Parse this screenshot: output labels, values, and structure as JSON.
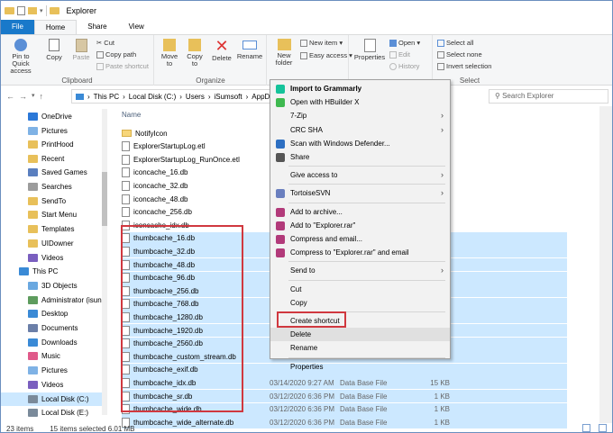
{
  "window": {
    "title": "Explorer"
  },
  "tabs": [
    {
      "label": "File"
    },
    {
      "label": "Home"
    },
    {
      "label": "Share"
    },
    {
      "label": "View"
    }
  ],
  "ribbon": {
    "clipboard": {
      "label": "Clipboard",
      "pin": "Pin to Quick access",
      "copy": "Copy",
      "paste": "Paste",
      "cut": "Cut",
      "copy_path": "Copy path",
      "paste_shortcut": "Paste shortcut"
    },
    "organize": {
      "label": "Organize",
      "move_to": "Move to",
      "copy_to": "Copy to",
      "delete": "Delete",
      "rename": "Rename"
    },
    "new": {
      "new_folder": "New folder",
      "new_item": "New item ▾",
      "easy_access": "Easy access ▾"
    },
    "open": {
      "properties": "Properties",
      "open": "Open ▾",
      "edit": "Edit",
      "history": "History"
    },
    "select": {
      "label": "Select",
      "select_all": "Select all",
      "select_none": "Select none",
      "invert": "Invert selection"
    }
  },
  "address": {
    "crumbs": [
      "This PC",
      "Local Disk (C:)",
      "Users",
      "iSumsoft",
      "AppD"
    ],
    "search_placeholder": "Search Explorer"
  },
  "sidebar": [
    {
      "label": "OneDrive",
      "color": "#2b78d8"
    },
    {
      "label": "Pictures",
      "color": "#7fb2e5"
    },
    {
      "label": "PrintHood",
      "color": "#e8c05a"
    },
    {
      "label": "Recent",
      "color": "#e8c05a"
    },
    {
      "label": "Saved Games",
      "color": "#5a7fbf"
    },
    {
      "label": "Searches",
      "color": "#9c9c9c"
    },
    {
      "label": "SendTo",
      "color": "#e8c05a"
    },
    {
      "label": "Start Menu",
      "color": "#e8c05a"
    },
    {
      "label": "Templates",
      "color": "#e8c05a"
    },
    {
      "label": "UIDowner",
      "color": "#e8c05a"
    },
    {
      "label": "Videos",
      "color": "#7a5fbf"
    },
    {
      "label": "This PC",
      "color": "#3a8ad6"
    },
    {
      "label": "3D Objects",
      "color": "#6aa8e0"
    },
    {
      "label": "Administrator (isuns",
      "color": "#5e9c5e"
    },
    {
      "label": "Desktop",
      "color": "#3a8ad6"
    },
    {
      "label": "Documents",
      "color": "#6b7fa8"
    },
    {
      "label": "Downloads",
      "color": "#3a8ad6"
    },
    {
      "label": "Music",
      "color": "#e05a8a"
    },
    {
      "label": "Pictures",
      "color": "#7fb2e5"
    },
    {
      "label": "Videos",
      "color": "#7a5fbf"
    },
    {
      "label": "Local Disk (C:)",
      "color": "#7a8a9a"
    },
    {
      "label": "Local Disk (E:)",
      "color": "#7a8a9a"
    }
  ],
  "files": {
    "header": "Name",
    "rows": [
      {
        "name": "NotifyIcon",
        "type_icon": "folder",
        "sel": false,
        "date": "",
        "ftype": "",
        "size": ""
      },
      {
        "name": "ExplorerStartupLog.etl",
        "type_icon": "file",
        "sel": false,
        "date": "",
        "ftype": "",
        "size": ""
      },
      {
        "name": "ExplorerStartupLog_RunOnce.etl",
        "type_icon": "file",
        "sel": false,
        "date": "",
        "ftype": "",
        "size": ""
      },
      {
        "name": "iconcache_16.db",
        "type_icon": "file",
        "sel": false,
        "date": "",
        "ftype": "",
        "size": ""
      },
      {
        "name": "iconcache_32.db",
        "type_icon": "file",
        "sel": false,
        "date": "",
        "ftype": "",
        "size": ""
      },
      {
        "name": "iconcache_48.db",
        "type_icon": "file",
        "sel": false,
        "date": "",
        "ftype": "",
        "size": ""
      },
      {
        "name": "iconcache_256.db",
        "type_icon": "file",
        "sel": false,
        "date": "",
        "ftype": "",
        "size": ""
      },
      {
        "name": "iconcache_idx.db",
        "type_icon": "file",
        "sel": false,
        "date": "",
        "ftype": "",
        "size": ""
      },
      {
        "name": "thumbcache_16.db",
        "type_icon": "file",
        "sel": true,
        "date": "",
        "ftype": "",
        "size": ""
      },
      {
        "name": "thumbcache_32.db",
        "type_icon": "file",
        "sel": true,
        "date": "",
        "ftype": "",
        "size": ""
      },
      {
        "name": "thumbcache_48.db",
        "type_icon": "file",
        "sel": true,
        "date": "",
        "ftype": "",
        "size": ""
      },
      {
        "name": "thumbcache_96.db",
        "type_icon": "file",
        "sel": true,
        "date": "",
        "ftype": "",
        "size": ""
      },
      {
        "name": "thumbcache_256.db",
        "type_icon": "file",
        "sel": true,
        "date": "",
        "ftype": "",
        "size": ""
      },
      {
        "name": "thumbcache_768.db",
        "type_icon": "file",
        "sel": true,
        "date": "",
        "ftype": "",
        "size": ""
      },
      {
        "name": "thumbcache_1280.db",
        "type_icon": "file",
        "sel": true,
        "date": "",
        "ftype": "",
        "size": ""
      },
      {
        "name": "thumbcache_1920.db",
        "type_icon": "file",
        "sel": true,
        "date": "",
        "ftype": "",
        "size": ""
      },
      {
        "name": "thumbcache_2560.db",
        "type_icon": "file",
        "sel": true,
        "date": "",
        "ftype": "",
        "size": ""
      },
      {
        "name": "thumbcache_custom_stream.db",
        "type_icon": "file",
        "sel": true,
        "date": "",
        "ftype": "",
        "size": ""
      },
      {
        "name": "thumbcache_exif.db",
        "type_icon": "file",
        "sel": true,
        "date": "",
        "ftype": "",
        "size": ""
      },
      {
        "name": "thumbcache_idx.db",
        "type_icon": "file",
        "sel": true,
        "date": "03/14/2020 9:27 AM",
        "ftype": "Data Base File",
        "size": "15 KB"
      },
      {
        "name": "thumbcache_sr.db",
        "type_icon": "file",
        "sel": true,
        "date": "03/12/2020 6:36 PM",
        "ftype": "Data Base File",
        "size": "1 KB"
      },
      {
        "name": "thumbcache_wide.db",
        "type_icon": "file",
        "sel": true,
        "date": "03/12/2020 6:36 PM",
        "ftype": "Data Base File",
        "size": "1 KB"
      },
      {
        "name": "thumbcache_wide_alternate.db",
        "type_icon": "file",
        "sel": true,
        "date": "03/12/2020 6:36 PM",
        "ftype": "Data Base File",
        "size": "1 KB"
      }
    ]
  },
  "context_menu": [
    {
      "label": "Import to Grammarly",
      "bold": true,
      "icon": "#15c39a",
      "arrow": false
    },
    {
      "label": "Open with HBuilder X",
      "bold": false,
      "icon": "#3fb950",
      "arrow": false
    },
    {
      "label": "7-Zip",
      "bold": false,
      "icon": "",
      "arrow": true
    },
    {
      "label": "CRC SHA",
      "bold": false,
      "icon": "",
      "arrow": true
    },
    {
      "label": "Scan with Windows Defender...",
      "bold": false,
      "icon": "#2d6fc2",
      "arrow": false
    },
    {
      "label": "Share",
      "bold": false,
      "icon": "#555555",
      "arrow": false
    },
    {
      "sep": true
    },
    {
      "label": "Give access to",
      "bold": false,
      "icon": "",
      "arrow": true
    },
    {
      "sep": true
    },
    {
      "label": "TortoiseSVN",
      "bold": false,
      "icon": "#6a7fbf",
      "arrow": true
    },
    {
      "sep": true
    },
    {
      "label": "Add to archive...",
      "bold": false,
      "icon": "#b23a7a",
      "arrow": false
    },
    {
      "label": "Add to \"Explorer.rar\"",
      "bold": false,
      "icon": "#b23a7a",
      "arrow": false
    },
    {
      "label": "Compress and email...",
      "bold": false,
      "icon": "#b23a7a",
      "arrow": false
    },
    {
      "label": "Compress to \"Explorer.rar\" and email",
      "bold": false,
      "icon": "#b23a7a",
      "arrow": false
    },
    {
      "sep": true
    },
    {
      "label": "Send to",
      "bold": false,
      "icon": "",
      "arrow": true
    },
    {
      "sep": true
    },
    {
      "label": "Cut",
      "bold": false,
      "icon": "",
      "arrow": false
    },
    {
      "label": "Copy",
      "bold": false,
      "icon": "",
      "arrow": false
    },
    {
      "sep": true
    },
    {
      "label": "Create shortcut",
      "bold": false,
      "icon": "",
      "arrow": false
    },
    {
      "label": "Delete",
      "bold": false,
      "icon": "",
      "arrow": false,
      "highlight": true
    },
    {
      "label": "Rename",
      "bold": false,
      "icon": "",
      "arrow": false
    },
    {
      "sep": true
    },
    {
      "label": "Properties",
      "bold": false,
      "icon": "",
      "arrow": false
    }
  ],
  "status": {
    "items": "23 items",
    "selected": "15 items selected  6.01 MB"
  }
}
